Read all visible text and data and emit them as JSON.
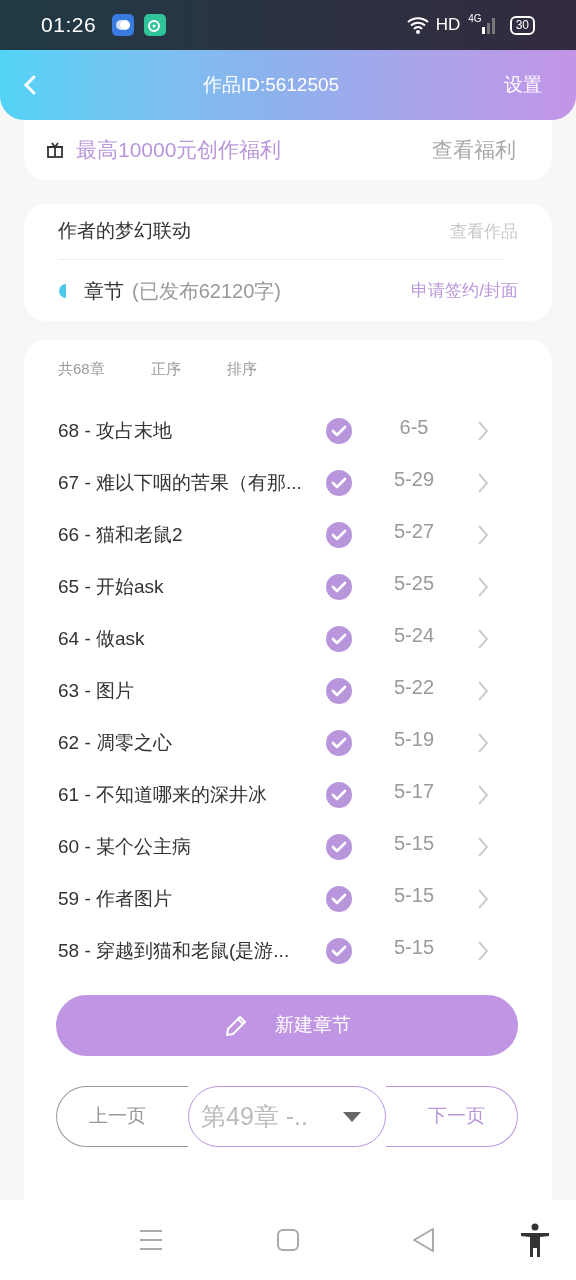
{
  "status_bar": {
    "time": "01:26",
    "network": "HD",
    "signal_type": "4G",
    "battery": "30"
  },
  "header": {
    "title": "作品ID:5612505",
    "action": "设置"
  },
  "welfare": {
    "text": "最高10000元创作福利",
    "link": "查看福利"
  },
  "work": {
    "title": "作者的梦幻联动",
    "link": "查看作品",
    "section": "章节",
    "section_note": "(已发布62120字)",
    "action": "申请签约/封面"
  },
  "chapters_header": {
    "count": "共68章",
    "order": "正序",
    "sort": "排序"
  },
  "chapters": [
    {
      "title": "68 - 攻占末地",
      "checked": true,
      "date": "6-5"
    },
    {
      "title": "67 - 难以下咽的苦果（有那...",
      "checked": true,
      "date": "5-29"
    },
    {
      "title": "66 - 猫和老鼠2",
      "checked": true,
      "date": "5-27"
    },
    {
      "title": "65 - 开始ask",
      "checked": true,
      "date": "5-25"
    },
    {
      "title": "64 - 做ask",
      "checked": true,
      "date": "5-24"
    },
    {
      "title": "63 - 图片",
      "checked": true,
      "date": "5-22"
    },
    {
      "title": "62 - 凋零之心",
      "checked": true,
      "date": "5-19"
    },
    {
      "title": "61 - 不知道哪来的深井冰",
      "checked": true,
      "date": "5-17"
    },
    {
      "title": "60 - 某个公主病",
      "checked": true,
      "date": "5-15"
    },
    {
      "title": "59 - 作者图片",
      "checked": true,
      "date": "5-15"
    },
    {
      "title": "58 - 穿越到猫和老鼠(是游...",
      "checked": true,
      "date": "5-15"
    }
  ],
  "new_chapter_button": "新建章节",
  "pager": {
    "prev": "上一页",
    "select": "第49章 -..",
    "next": "下一页"
  }
}
